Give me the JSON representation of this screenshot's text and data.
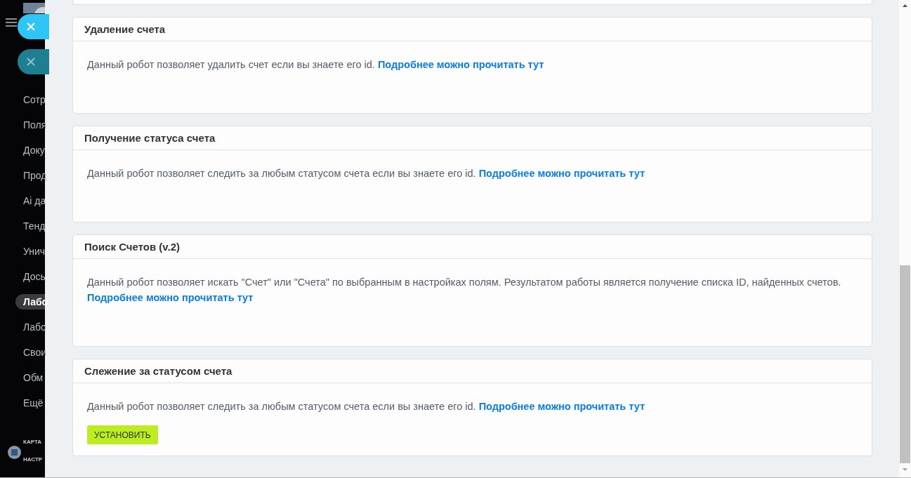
{
  "sidebar": {
    "items": [
      {
        "label": "Сотр",
        "selected": false
      },
      {
        "label": "Поля",
        "selected": false
      },
      {
        "label": "Доку",
        "selected": false
      },
      {
        "label": "Прод",
        "selected": false
      },
      {
        "label": "Ai да",
        "selected": false
      },
      {
        "label": "Тенд",
        "selected": false
      },
      {
        "label": "Унич",
        "selected": false
      },
      {
        "label": "Дось",
        "selected": false
      },
      {
        "label": "Лабо",
        "selected": true
      },
      {
        "label": "Лабо",
        "selected": false
      },
      {
        "label": "Свои",
        "selected": false
      },
      {
        "label": "Обм",
        "selected": false
      },
      {
        "label": "Ещё",
        "selected": false
      }
    ],
    "footer": {
      "heading": "КАРТА",
      "settings": "НАСТР"
    }
  },
  "cards": [
    {
      "title": "Удаление счета",
      "text": "Данный робот позволяет удалить счет если вы знаете его id.",
      "link": "Подробнее можно прочитать тут"
    },
    {
      "title": "Получение статуса счета",
      "text": "Данный робот позволяет следить за любым статусом счета если вы знаете его id.",
      "link": "Подробнее можно прочитать тут"
    },
    {
      "title": "Поиск Счетов (v.2)",
      "text": "Данный робот позволяет искать \"Счет\" или \"Счета\" по выбранным в настройках полям. Результатом работы является получение списка ID, найденных счетов.",
      "link": "Подробнее можно прочитать тут"
    },
    {
      "title": "Слежение за статусом счета",
      "text": "Данный робот позволяет следить за любым статусом счета если вы знаете его id.",
      "link": "Подробнее можно прочитать тут",
      "button": "УСТАНОВИТЬ"
    }
  ]
}
